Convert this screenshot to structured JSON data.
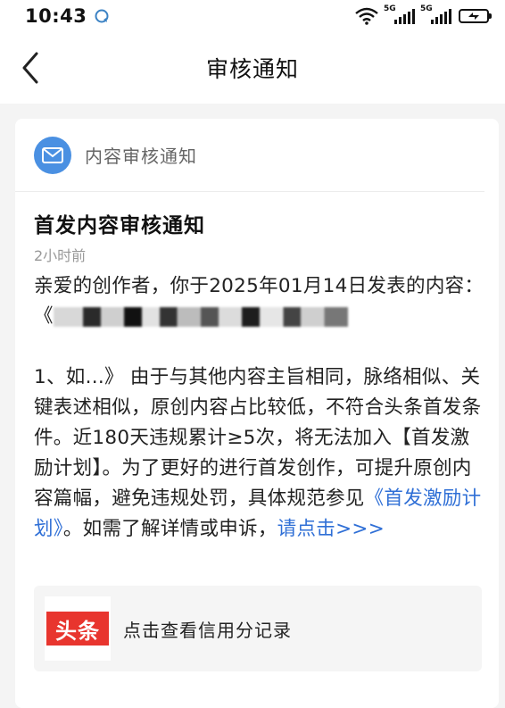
{
  "status_bar": {
    "time": "10:43",
    "network_1": "5G",
    "network_2": "5G",
    "icons": [
      "chat-bubble-icon",
      "wifi-icon",
      "signal-icon",
      "battery-charging-icon"
    ]
  },
  "nav": {
    "back_icon": "chevron-left-icon",
    "title": "审核通知"
  },
  "card": {
    "header_icon": "mail-icon",
    "header_label": "内容审核通知",
    "title": "首发内容审核通知",
    "time": "2小时前",
    "body_line1": "亲爱的创作者，你于2025年01月14日发表的内容：《",
    "body_after_redaction": "1、如...》 由于与其他内容主旨相同，脉络相似、关键表述相似，原创内容占比较低，不符合头条首发条件。近180天违规累计≥5次，将无法加入【首发激励计划】。为了更好的进行首发创作，可提升原创内容篇幅，避免违规处罚，具体规范参见",
    "rules_link": "《首发激励计划》",
    "body_tail": "。如需了解详情或申诉，",
    "appeal_link": "请点击>>>"
  },
  "credit": {
    "logo_text": "头条",
    "label": "点击查看信用分记录"
  },
  "colors": {
    "accent_blue": "#2f6fd6",
    "mail_icon_bg": "#4a90e2",
    "logo_red": "#e8352e"
  }
}
